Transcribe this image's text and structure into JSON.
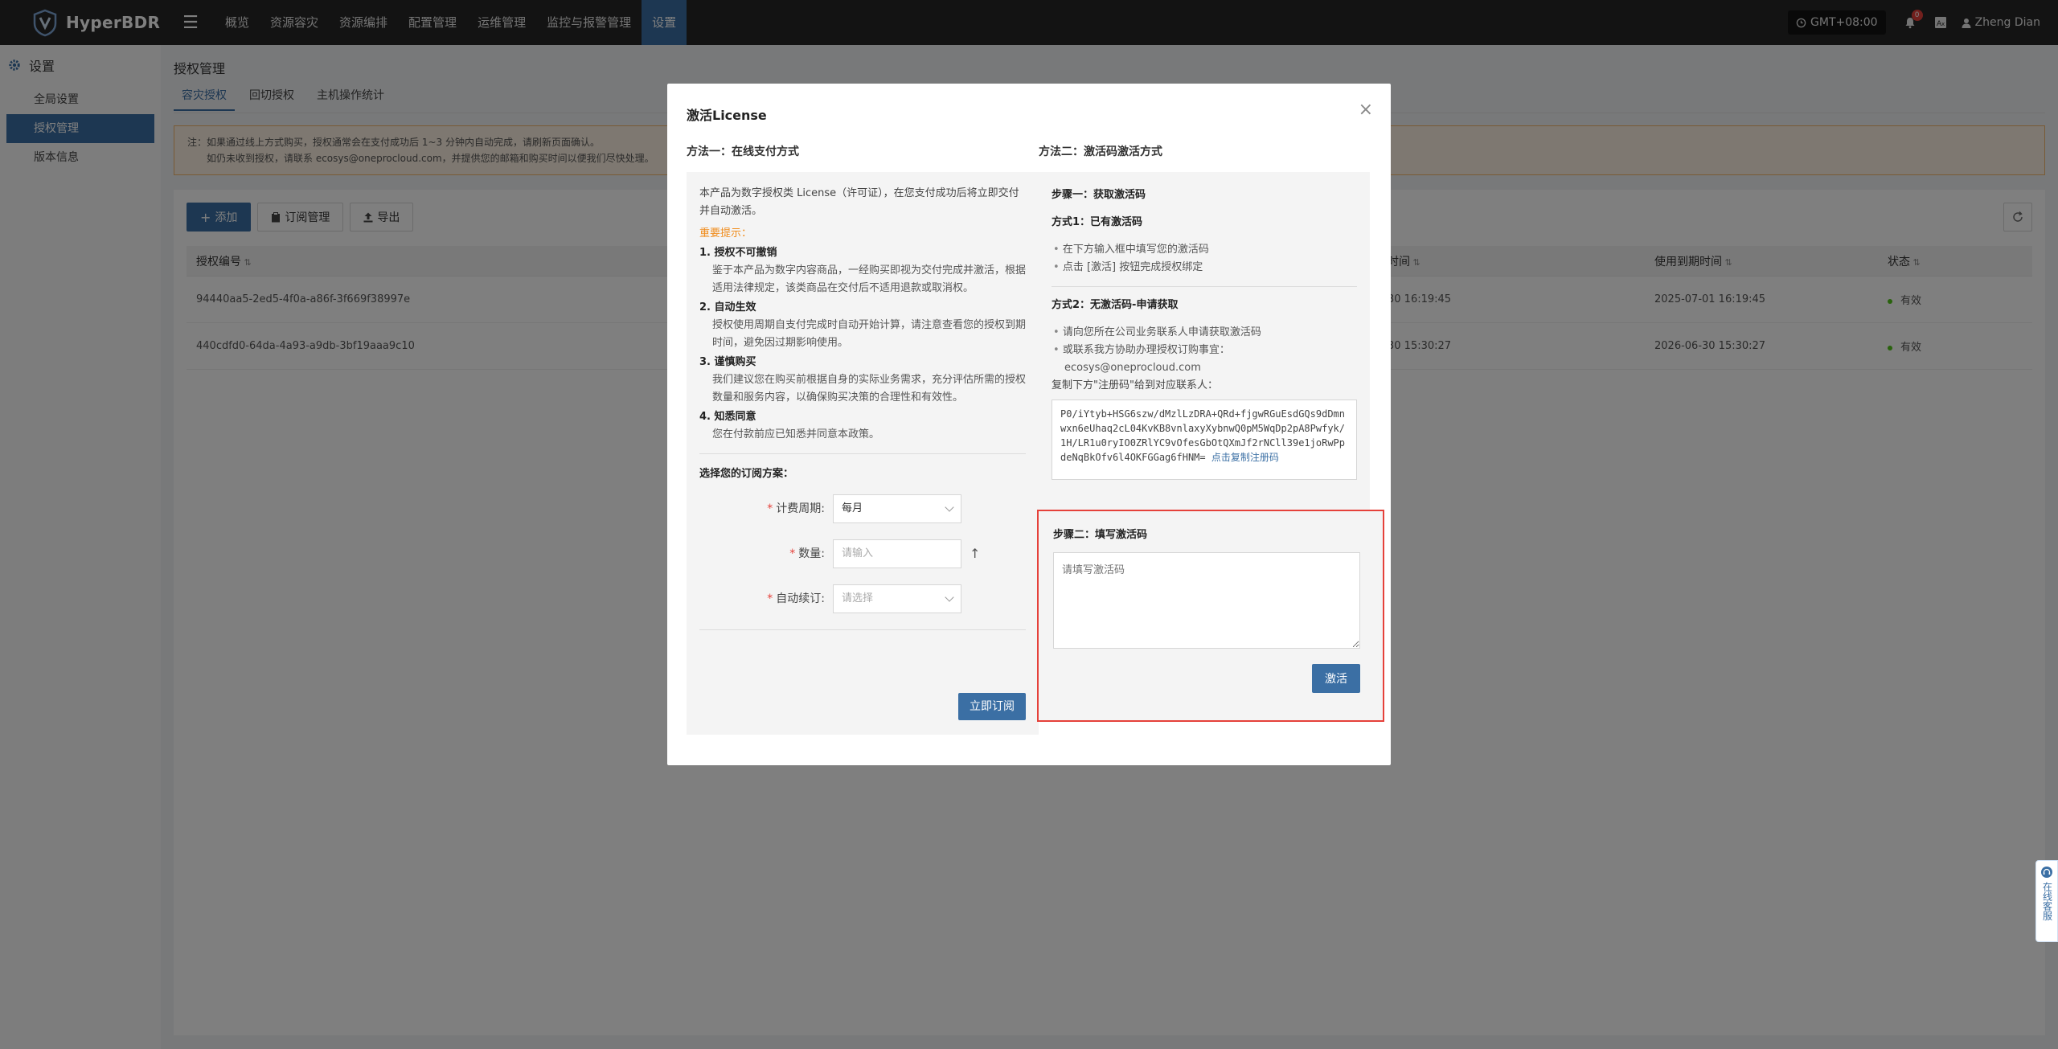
{
  "app": {
    "name": "HyperBDR"
  },
  "nav": {
    "items": [
      "概览",
      "资源容灾",
      "资源编排",
      "配置管理",
      "运维管理",
      "监控与报警管理",
      "设置"
    ],
    "active_index": 6
  },
  "topright": {
    "timezone": "GMT+08:00",
    "notification_count": "0",
    "user": "Zheng Dian"
  },
  "sidebar": {
    "title": "设置",
    "items": [
      {
        "label": "全局设置"
      },
      {
        "label": "授权管理"
      },
      {
        "label": "版本信息"
      }
    ],
    "active_index": 1
  },
  "page": {
    "title": "授权管理",
    "tabs": [
      "容灾授权",
      "回切授权",
      "主机操作统计"
    ],
    "active_tab": 0,
    "notice": {
      "line1": "注：如果通过线上方式购买，授权通常会在支付成功后 1~3 分钟内自动完成，请刷新页面确认。",
      "line2": "如仍未收到授权，请联系 ecosys@oneprocloud.com，并提供您的邮箱和购买时间以便我们尽快处理。"
    },
    "toolbar": {
      "add": "添加",
      "subscription": "订阅管理",
      "export": "导出"
    },
    "table": {
      "headers": {
        "id": "授权编号",
        "time_partial": "时间",
        "expire": "使用到期时间",
        "status": "状态"
      },
      "rows": [
        {
          "id": "94440aa5-2ed5-4f0a-a86f-3f669f38997e",
          "time_partial": "30 16:19:45",
          "expire": "2025-07-01 16:19:45",
          "status": "有效"
        },
        {
          "id": "440cdfd0-64da-4a93-a9db-3bf19aaa9c10",
          "time_partial": "30 15:30:27",
          "expire": "2026-06-30 15:30:27",
          "status": "有效"
        }
      ]
    }
  },
  "modal": {
    "title": "激活License",
    "left": {
      "heading": "方法一：在线支付方式",
      "intro": "本产品为数字授权类 License（许可证），在您支付成功后将立即交付并自动激活。",
      "important": "重要提示：",
      "rules": [
        {
          "title": "1. 授权不可撤销",
          "body": "鉴于本产品为数字内容商品，一经购买即视为交付完成并激活，根据适用法律规定，该类商品在交付后不适用退款或取消权。"
        },
        {
          "title": "2. 自动生效",
          "body": "授权使用周期自支付完成时自动开始计算，请注意查看您的授权到期时间，避免因过期影响使用。"
        },
        {
          "title": "3. 谨慎购买",
          "body": "我们建议您在购买前根据自身的实际业务需求，充分评估所需的授权数量和服务内容，以确保购买决策的合理性和有效性。"
        },
        {
          "title": "4. 知悉同意",
          "body": "您在付款前应已知悉并同意本政策。"
        }
      ],
      "plan_title": "选择您的订阅方案：",
      "form": {
        "period_label": "计费周期:",
        "period_value": "每月",
        "quantity_label": "数量:",
        "quantity_placeholder": "请输入",
        "auto_label": "自动续订:",
        "auto_placeholder": "请选择"
      },
      "subscribe": "立即订阅"
    },
    "right": {
      "heading": "方法二：激活码激活方式",
      "step1": "步骤一：获取激活码",
      "way1": "方式1：已有激活码",
      "way1_items": [
        "在下方输入框中填写您的激活码",
        "点击 [激活] 按钮完成授权绑定"
      ],
      "way2": "方式2：无激活码-申请获取",
      "way2_items": [
        "请向您所在公司业务联系人申请获取激活码",
        "或联系我方协助办理授权订购事宜："
      ],
      "email": "ecosys@oneprocloud.com",
      "copy_hint": "复制下方\"注册码\"给到对应联系人：",
      "regcode": "P0/iYtyb+HSG6szw/dMzlLzDRA+QRd+fjgwRGuEsdGQs9dDmnwxn6eUhaq2cL04KvKB8vnlaxyXybnwQ0pM5WqDp2pA8Pwfyk/1H/LR1u0ryIO0ZRlYC9vOfesGbOtQXmJf2rNCll39e1joRwPpdeNqBkOfv6l4OKFGGag6fHNM=",
      "copy_link": "点击复制注册码",
      "step2": "步骤二：填写激活码",
      "code_placeholder": "请填写激活码",
      "activate": "激活"
    }
  },
  "service": {
    "label": "在线客服"
  }
}
